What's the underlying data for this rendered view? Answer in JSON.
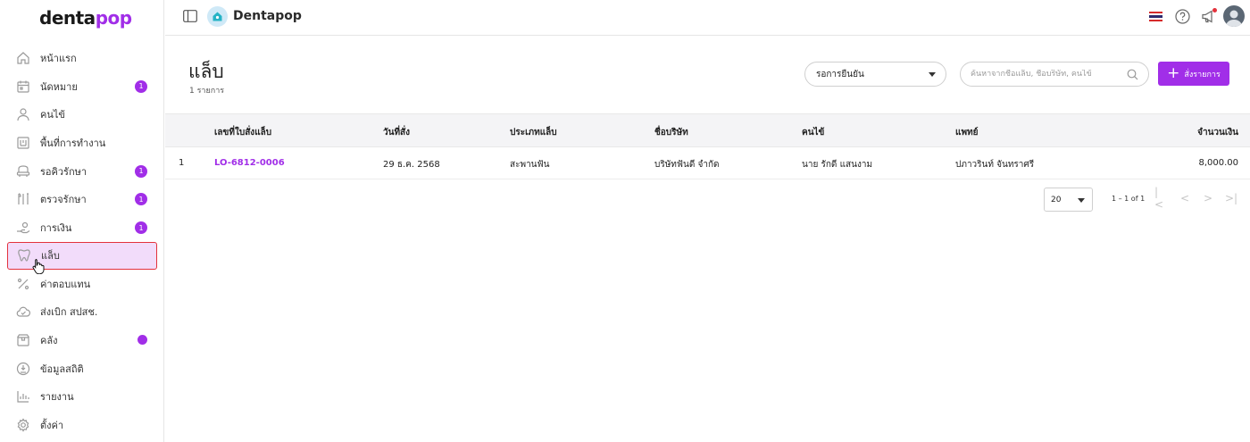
{
  "sidebar": {
    "logo_main": "denta",
    "logo_accent": "pop",
    "items": [
      {
        "label": "หน้าแรก",
        "icon": "home-icon",
        "badge": ""
      },
      {
        "label": "นัดหมาย",
        "icon": "calendar-icon",
        "badge": "1"
      },
      {
        "label": "คนไข้",
        "icon": "user-icon",
        "badge": ""
      },
      {
        "label": "พื้นที่การทำงาน",
        "icon": "workspace-icon",
        "badge": ""
      },
      {
        "label": "รอคิวรักษา",
        "icon": "dental-chair-icon",
        "badge": "1"
      },
      {
        "label": "ตรวจรักษา",
        "icon": "dental-tools-icon",
        "badge": "1"
      },
      {
        "label": "การเงิน",
        "icon": "money-hand-icon",
        "badge": "1"
      },
      {
        "label": "แล็บ",
        "icon": "tooth-icon",
        "badge": ""
      },
      {
        "label": "ค่าตอบแทน",
        "icon": "percent-icon",
        "badge": ""
      },
      {
        "label": "ส่งเบิก สปสช.",
        "icon": "cloud-icon",
        "badge": ""
      },
      {
        "label": "คลัง",
        "icon": "box-icon",
        "badge": ""
      },
      {
        "label": "ข้อมูลสถิติ",
        "icon": "stats-icon",
        "badge": ""
      },
      {
        "label": "รายงาน",
        "icon": "report-icon",
        "badge": ""
      },
      {
        "label": "ตั้งค่า",
        "icon": "gear-icon",
        "badge": ""
      }
    ],
    "active_index": 7
  },
  "header": {
    "brand_name": "Dentapop"
  },
  "page": {
    "title": "แล็บ",
    "subtitle": "1 รายการ",
    "status_filter": "รอการยืนยัน",
    "search_placeholder": "ค้นหาจากชื่อแล็บ, ชื่อบริษัท, คนไข้",
    "add_button": "สั่งรายการ"
  },
  "table": {
    "columns": [
      "เลขที่ใบสั่งแล็บ",
      "วันที่สั่ง",
      "ประเภทแล็บ",
      "ชื่อบริษัท",
      "คนไข้",
      "แพทย์",
      "จำนวนเงิน"
    ],
    "rows": [
      {
        "index": "1",
        "order_no": "LO-6812-0006",
        "date": "29 ธ.ค. 2568",
        "lab_type": "สะพานฟัน",
        "company": "บริษัทฟันดี จำกัด",
        "patient": "นาย รักดี แสนงาม",
        "doctor": "ปภาวรินท์ จันทราศรี",
        "amount": "8,000.00"
      }
    ]
  },
  "pagination": {
    "page_size": "20",
    "range": "1 – 1 of 1"
  },
  "colors": {
    "accent": "#a12ee8",
    "active_bg": "#f2dcfa",
    "active_border": "#e3323c"
  }
}
